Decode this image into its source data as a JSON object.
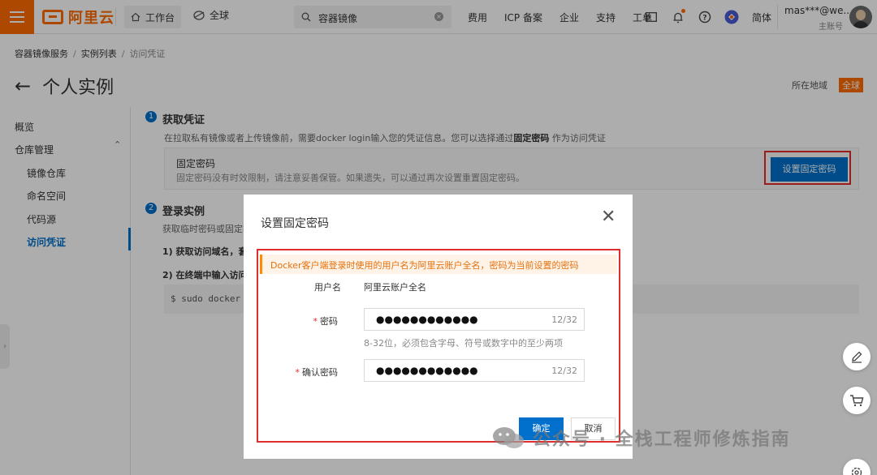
{
  "topbar": {
    "logo_text": "阿里云",
    "workspace_label": "工作台",
    "region_label": "全球",
    "search_text": "容器镜像",
    "nav_links": [
      "费用",
      "ICP 备案",
      "企业",
      "支持",
      "工单"
    ],
    "lang": "简体",
    "account_name": "mas***@we...",
    "account_type": "主账号"
  },
  "breadcrumb": [
    "容器镜像服务",
    "实例列表",
    "访问凭证"
  ],
  "page": {
    "title": "个人实例",
    "region_label": "所在地域",
    "region_value": "全球"
  },
  "sidebar": {
    "overview": "概览",
    "repo_manage": "仓库管理",
    "image_repo": "镜像仓库",
    "namespace": "命名空间",
    "code_source": "代码源",
    "access_cred": "访问凭证"
  },
  "step1": {
    "num": "1",
    "title": "获取凭证",
    "desc_pre": "在拉取私有镜像或者上传镜像前，需要docker login输入您的凭证信息。您可以选择通过",
    "desc_bold": "固定密码",
    "desc_post": "作为访问凭证",
    "box_title": "固定密码",
    "box_desc": "固定密码没有时效限制，请注意妥善保管。如果遗失，可以通过再次设置重置固定密码。",
    "button": "设置固定密码"
  },
  "step2": {
    "num": "2",
    "title": "登录实例",
    "desc": "获取临时密码或固定密",
    "line1": "1) 获取访问域名，套",
    "line2": "2) 在终端中输入访问",
    "cmd": "$ sudo docker l"
  },
  "modal": {
    "title": "设置固定密码",
    "alert": "Docker客户端登录时使用的用户名为阿里云账户全名，密码为当前设置的密码",
    "username_label": "用户名",
    "username_value": "阿里云账户全名",
    "password_label": "密码",
    "password_mask": "●●●●●●●●●●●●",
    "password_count": "12/32",
    "password_hint": "8-32位，必须包含字母、符号或数字中的至少两项",
    "confirm_label": "确认密码",
    "confirm_mask": "●●●●●●●●●●●●",
    "confirm_count": "12/32",
    "ok": "确定",
    "cancel": "取消"
  },
  "watermark": "公众号 · 全栈工程师修炼指南",
  "colors": {
    "brand": "#ff6a00",
    "primary": "#0070cc",
    "highlight_border": "#e02d2d"
  }
}
